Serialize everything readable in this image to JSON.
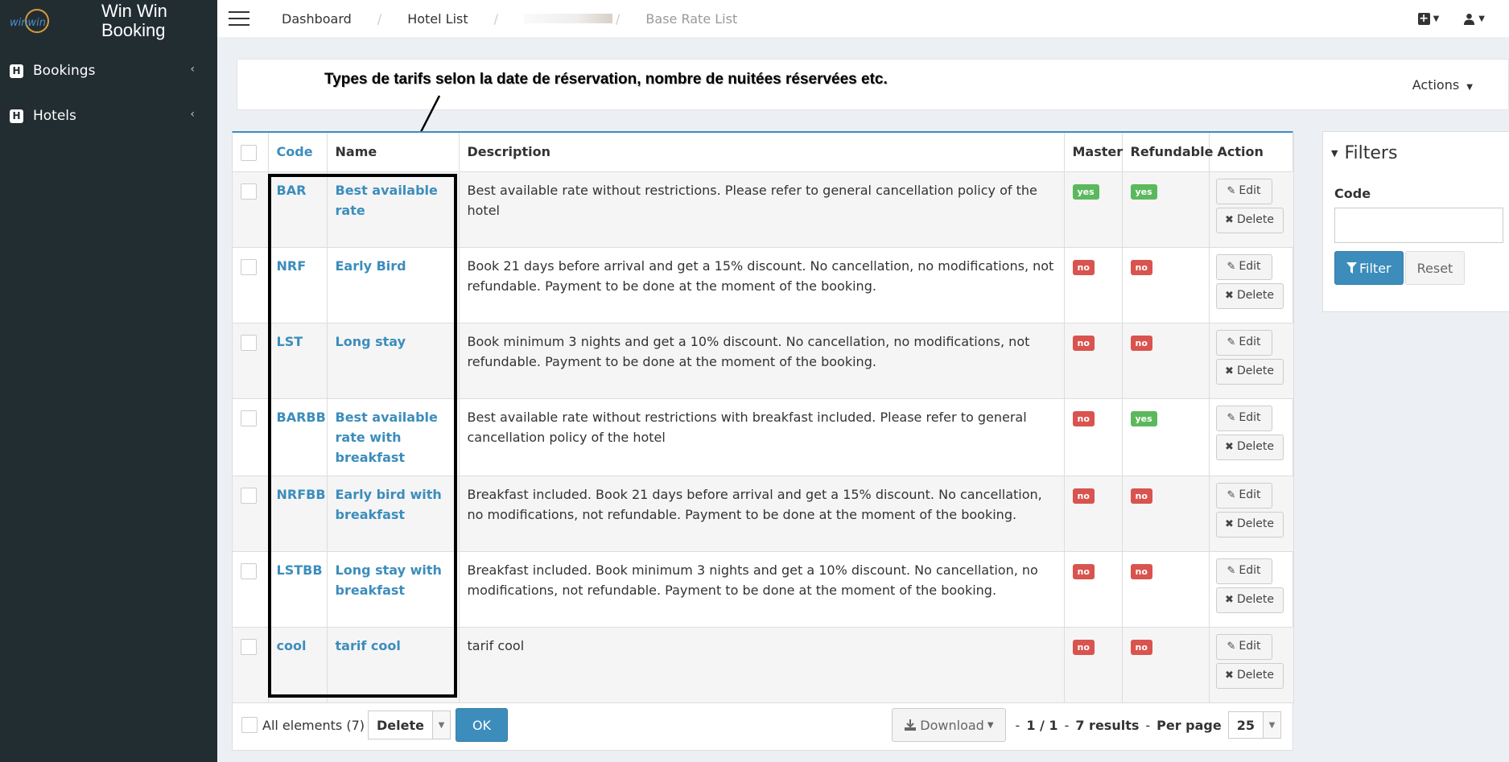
{
  "app": {
    "title_line1": "Win Win",
    "title_line2": "Booking",
    "logo_text": "winwin"
  },
  "sidebar": {
    "items": [
      {
        "label": "Bookings",
        "icon": "H"
      },
      {
        "label": "Hotels",
        "icon": "H"
      }
    ],
    "chevron": "‹"
  },
  "header": {
    "breadcrumb": {
      "dashboard": "Dashboard",
      "hotel_list": "Hotel List",
      "current": "Base Rate List",
      "sep": "/"
    },
    "plus_icon": "➕",
    "user_icon": "👤"
  },
  "annotation": {
    "text": "Types de tarifs selon la date de réservation, nombre de nuitées réservées etc."
  },
  "actions_label": "Actions",
  "table": {
    "headers": {
      "code": "Code",
      "name": "Name",
      "description": "Description",
      "master": "Master",
      "refundable": "Refundable",
      "action": "Action"
    },
    "edit_label": "Edit",
    "delete_label": "Delete",
    "rows": [
      {
        "code": "BAR",
        "name": "Best available rate",
        "description": "Best available rate without restrictions. Please refer to general cancellation policy of the hotel",
        "master": "yes",
        "refundable": "yes"
      },
      {
        "code": "NRF",
        "name": "Early Bird",
        "description": "Book 21 days before arrival and get a 15% discount. No cancellation, no modifications, not refundable. Payment to be done at the moment of the booking.",
        "master": "no",
        "refundable": "no"
      },
      {
        "code": "LST",
        "name": "Long stay",
        "description": "Book minimum 3 nights and get a 10% discount. No cancellation, no modifications, not refundable. Payment to be done at the moment of the booking.",
        "master": "no",
        "refundable": "no"
      },
      {
        "code": "BARBB",
        "name": "Best available rate with breakfast",
        "description": "Best available rate without restrictions with breakfast included. Please refer to general cancellation policy of the hotel",
        "master": "no",
        "refundable": "yes"
      },
      {
        "code": "NRFBB",
        "name": "Early bird with breakfast",
        "description": "Breakfast included. Book 21 days before arrival and get a 15% discount. No cancellation, no modifications, not refundable. Payment to be done at the moment of the booking.",
        "master": "no",
        "refundable": "no"
      },
      {
        "code": "LSTBB",
        "name": "Long stay with breakfast",
        "description": "Breakfast included. Book minimum 3 nights and get a 10% discount. No cancellation, no modifications, not refundable. Payment to be done at the moment of the booking.",
        "master": "no",
        "refundable": "no"
      },
      {
        "code": "cool",
        "name": "tarif cool",
        "description": "tarif cool",
        "master": "no",
        "refundable": "no"
      }
    ]
  },
  "footer": {
    "all_elements": "All elements (7)",
    "batch_action": "Delete",
    "ok": "OK",
    "download": "Download",
    "pager_prefix": "-",
    "page": "1 / 1",
    "results": "7 results",
    "per_page_label": "Per page",
    "per_page_value": "25"
  },
  "filters": {
    "title": "Filters",
    "code_label": "Code",
    "code_value": "",
    "filter_btn": "Filter",
    "reset_btn": "Reset"
  },
  "colors": {
    "primary": "#3c8dbc",
    "sidebar": "#222d32",
    "yes": "#5cb85c",
    "no": "#d9534f"
  }
}
